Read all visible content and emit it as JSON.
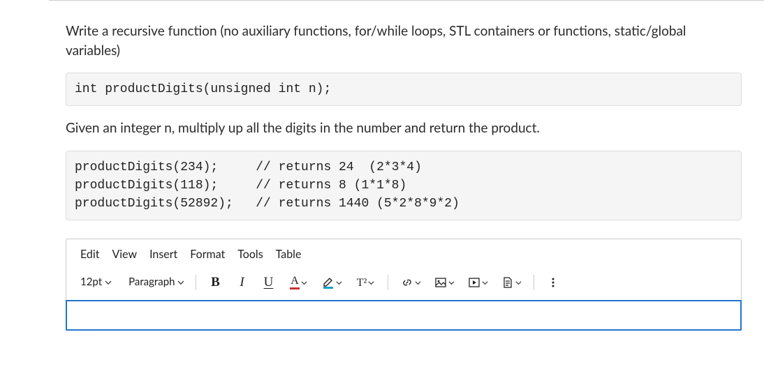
{
  "question": {
    "intro": "Write a recursive function (no auxiliary functions, for/while loops, STL containers or functions, static/global variables)",
    "signature_code": "int productDigits(unsigned int n);",
    "explanation": "Given an integer n, multiply up all the digits in the number and return the product.",
    "examples_code": "productDigits(234);     // returns 24  (2*3*4)\nproductDigits(118);     // returns 8 (1*1*8)\nproductDigits(52892);   // returns 1440 (5*2*8*9*2)"
  },
  "editor": {
    "menus": {
      "edit": "Edit",
      "view": "View",
      "insert": "Insert",
      "format": "Format",
      "tools": "Tools",
      "table": "Table"
    },
    "toolbar": {
      "font_size": "12pt",
      "block_format": "Paragraph",
      "bold": "B",
      "italic": "I",
      "underline": "U",
      "text_color": "A",
      "superscript": "T²"
    },
    "content": ""
  }
}
